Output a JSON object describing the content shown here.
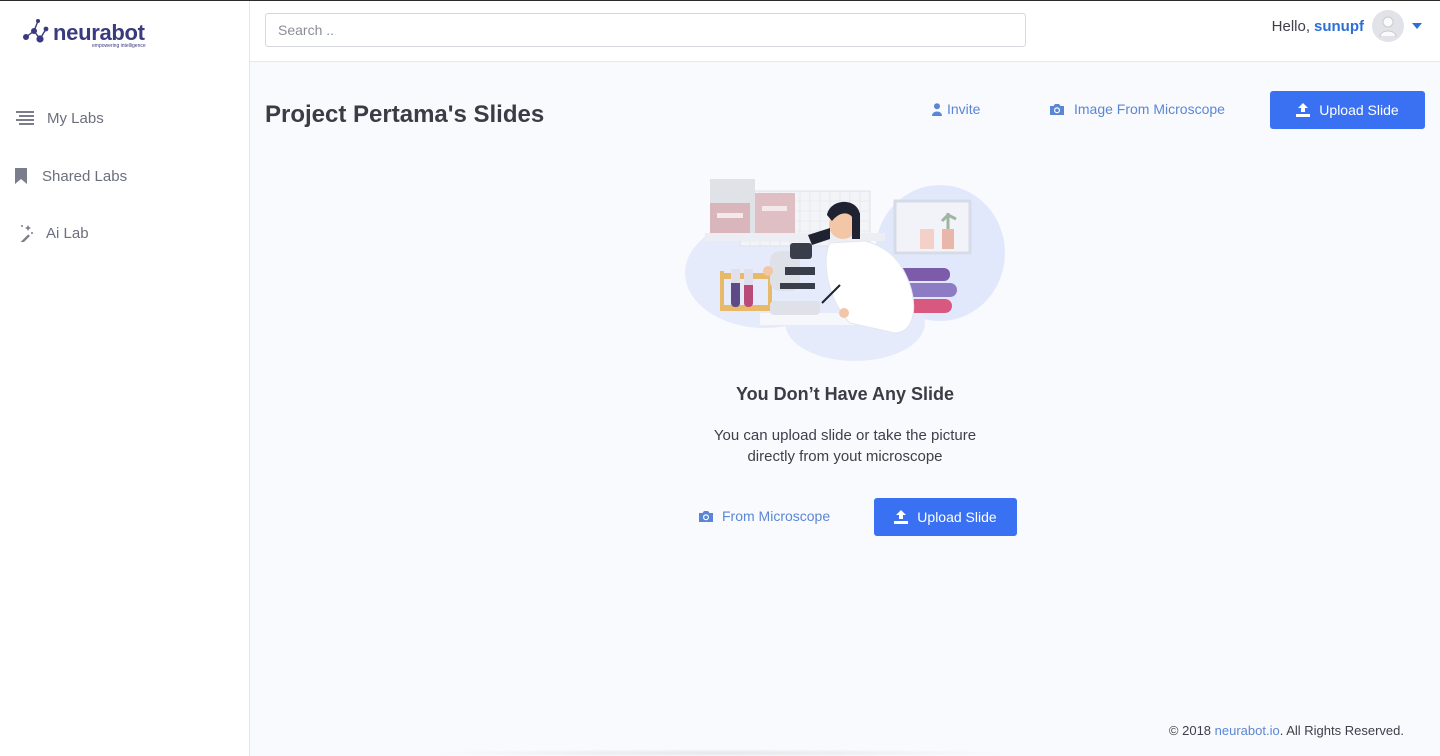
{
  "brand": {
    "name": "neurabot",
    "tagline": "empowering intelligence"
  },
  "sidebar": {
    "items": [
      {
        "label": "My Labs",
        "icon": "list-icon"
      },
      {
        "label": "Shared Labs",
        "icon": "bookmark-icon"
      },
      {
        "label": "Ai Lab",
        "icon": "magic-wand-icon"
      }
    ]
  },
  "header": {
    "search_placeholder": "Search ..",
    "greeting": "Hello,",
    "username": "sunupf"
  },
  "main": {
    "title": "Project Pertama's Slides",
    "invite_label": "Invite",
    "image_from_microscope_label": "Image From Microscope",
    "upload_slide_label": "Upload Slide"
  },
  "empty_state": {
    "title": "You Don’t Have Any Slide",
    "description_line1": "You can upload slide or take the picture",
    "description_line2": "directly from yout microscope",
    "from_microscope_label": "From Microscope",
    "upload_slide_label": "Upload Slide"
  },
  "footer": {
    "prefix": "© 2018 ",
    "brand_link": "neurabot.io",
    "suffix": ". All Rights Reserved."
  },
  "colors": {
    "accent": "#3a71f2",
    "link": "#5b86d6",
    "brand": "#3a3a80"
  }
}
